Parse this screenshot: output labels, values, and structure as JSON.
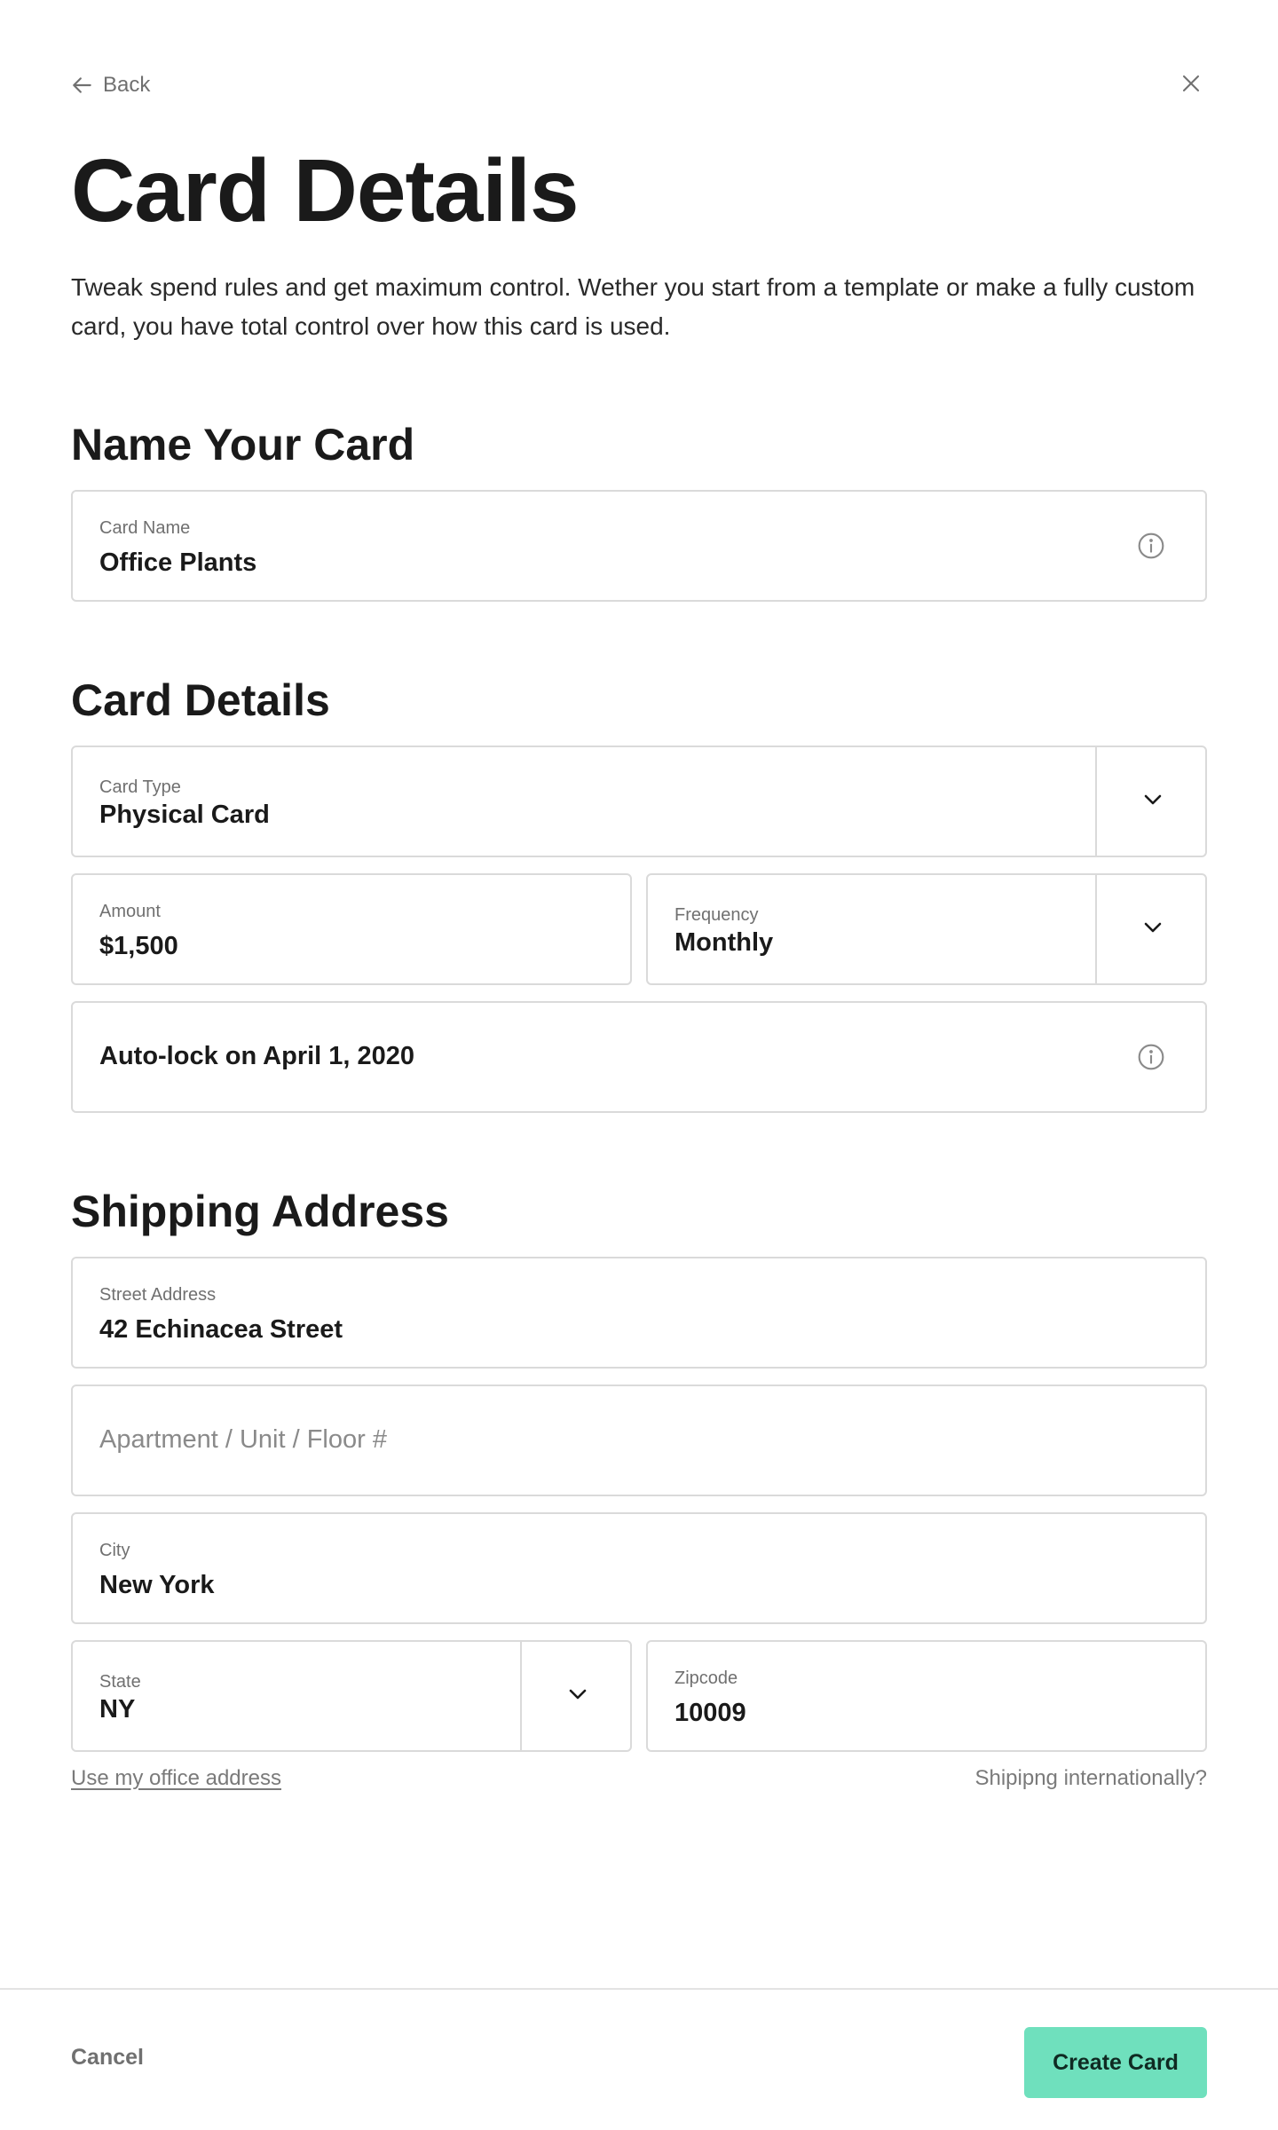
{
  "nav": {
    "back_label": "Back",
    "back_icon": "arrow-left-icon",
    "close_icon": "close-icon"
  },
  "page": {
    "title": "Card Details",
    "intro": "Tweak spend rules and get maximum control. Wether you start from a template or make a fully custom card, you have total control over how this card is used."
  },
  "name_section": {
    "title": "Name Your Card",
    "card_name": {
      "label": "Card Name",
      "value": "Office Plants",
      "icon": "info-icon"
    }
  },
  "details_section": {
    "title": "Card Details",
    "card_type": {
      "label": "Card Type",
      "value": "Physical Card",
      "icon": "chevron-down-icon"
    },
    "amount": {
      "label": "Amount",
      "value": "$1,500"
    },
    "frequency": {
      "label": "Frequency",
      "value": "Monthly",
      "icon": "chevron-down-icon"
    },
    "auto_lock": {
      "value": "Auto-lock on April 1, 2020",
      "icon": "info-icon"
    }
  },
  "shipping_section": {
    "title": "Shipping Address",
    "street": {
      "label": "Street Address",
      "value": "42 Echinacea Street"
    },
    "apartment": {
      "placeholder": "Apartment / Unit / Floor #"
    },
    "city": {
      "label": "City",
      "value": "New York"
    },
    "state": {
      "label": "State",
      "value": "NY",
      "icon": "chevron-down-icon"
    },
    "zipcode": {
      "label": "Zipcode",
      "value": "10009"
    },
    "use_office_link": "Use my office address",
    "international_link": "Shipipng internationally?"
  },
  "footer": {
    "cancel_label": "Cancel",
    "create_label": "Create Card"
  },
  "colors": {
    "accent": "#6fe0bd",
    "border": "#dadada",
    "text": "#1a1a1a",
    "muted": "#707070"
  }
}
